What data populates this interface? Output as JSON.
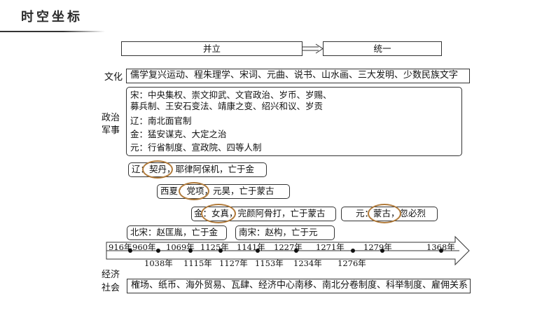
{
  "header": {
    "title": "时空坐标"
  },
  "phases": {
    "first": "并立",
    "second": "统一"
  },
  "labels": {
    "culture": "文化",
    "politics_1": "政治",
    "politics_2": "军事",
    "economy_1": "经济",
    "economy_2": "社会"
  },
  "culture_text": "儒学复兴运动、程朱理学、宋词、元曲、说书、山水画、三大发明、少数民族文字",
  "politics": {
    "song_1": "宋：中央集权、崇文抑武、文官政治、岁币、岁赐、",
    "song_2": "募兵制、王安石变法、靖康之变、绍兴和议、岁贡",
    "liao": "辽：南北面官制",
    "jin": "金：猛安谋克、大定之治",
    "yuan": "元：行省制度、宣政院、四等人制"
  },
  "regimes": {
    "liao": {
      "pre": "辽：",
      "ethnic": "契丹",
      "post": "，耶律阿保机，亡于金"
    },
    "xixia": {
      "pre": "西夏：",
      "ethnic": "党项",
      "post": "，元昊，亡于蒙古"
    },
    "jin": {
      "pre": "金：",
      "ethnic": "女真",
      "post": "，完颜阿骨打，亡于蒙古"
    },
    "yuan": {
      "pre": "元：",
      "ethnic": "蒙古",
      "post": "，忽必烈"
    },
    "north_song": "北宋：赵匡胤，亡于金",
    "south_song": "南宋：赵构，亡于元"
  },
  "timeline": {
    "top_years": [
      "916年",
      "960年",
      "1069年",
      "1125年",
      "1141年",
      "1227年",
      "1271年",
      "1279年",
      "1368年"
    ],
    "bottom_years": [
      "1038年",
      "1115年",
      "1127年",
      "1153年",
      "1234年",
      "1276年"
    ]
  },
  "economy_text": "榷场、纸币、海外贸易、瓦肆、经济中心南移、南北分卷制度、科举制度、雇佣关系",
  "colors": {
    "highlight": "#b07a3a",
    "line": "#333333"
  }
}
